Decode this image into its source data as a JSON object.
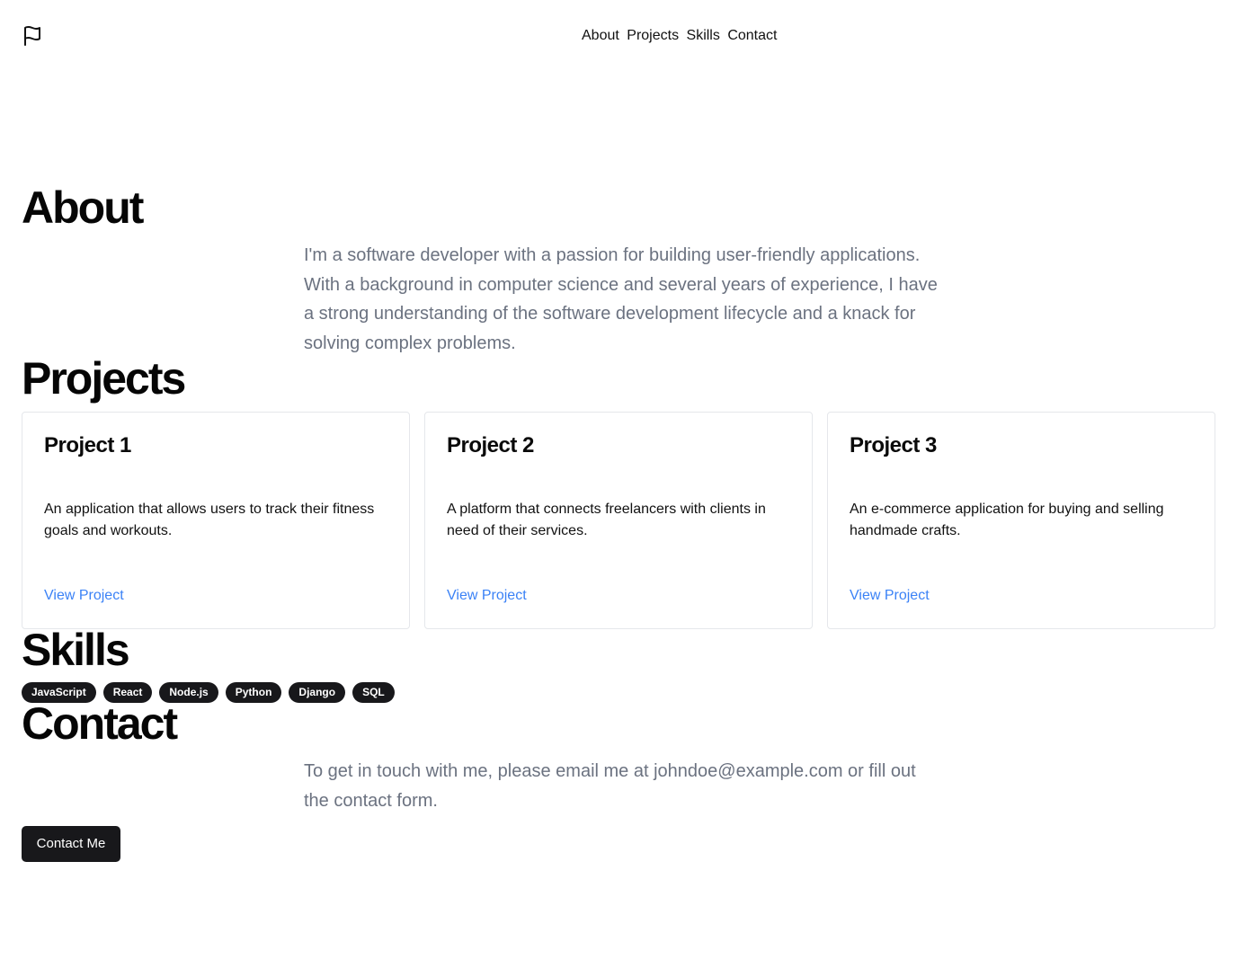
{
  "header": {
    "logo_icon": "flag-icon",
    "nav": [
      "About",
      "Projects",
      "Skills",
      "Contact"
    ]
  },
  "about": {
    "title": "About",
    "text": "I'm a software developer with a passion for building user-friendly applications. With a background in computer science and several years of experience, I have a strong understanding of the software development lifecycle and a knack for solving complex problems."
  },
  "projects": {
    "title": "Projects",
    "items": [
      {
        "title": "Project 1",
        "description": "An application that allows users to track their fitness goals and workouts.",
        "link": "View Project"
      },
      {
        "title": "Project 2",
        "description": "A platform that connects freelancers with clients in need of their services.",
        "link": "View Project"
      },
      {
        "title": "Project 3",
        "description": "An e-commerce application for buying and selling handmade crafts.",
        "link": "View Project"
      }
    ]
  },
  "skills": {
    "title": "Skills",
    "items": [
      "JavaScript",
      "React",
      "Node.js",
      "Python",
      "Django",
      "SQL"
    ]
  },
  "contact": {
    "title": "Contact",
    "text": "To get in touch with me, please email me at johndoe@example.com or fill out the contact form.",
    "button": "Contact Me"
  },
  "colors": {
    "link": "#3b82f6",
    "muted_text": "#6b7280",
    "dark": "#18181b"
  }
}
